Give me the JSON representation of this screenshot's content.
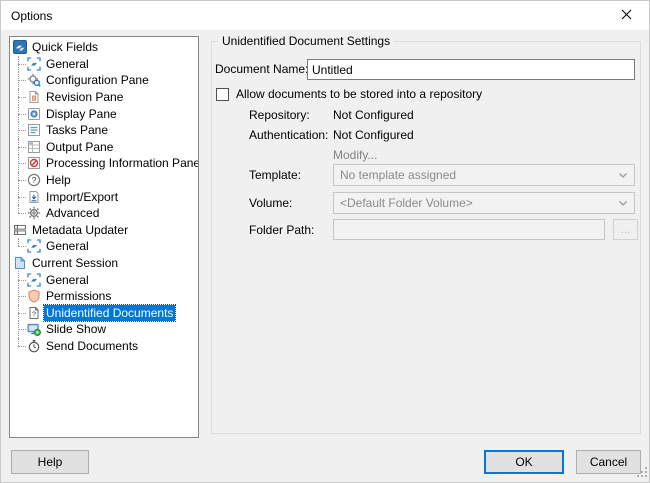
{
  "window": {
    "title": "Options"
  },
  "tree": {
    "items": [
      {
        "label": "Quick Fields",
        "level": 0,
        "icon": "quick-fields",
        "selected": false
      },
      {
        "label": "General",
        "level": 1,
        "icon": "general",
        "selected": false
      },
      {
        "label": "Configuration Pane",
        "level": 1,
        "icon": "configuration-pane",
        "selected": false
      },
      {
        "label": "Revision Pane",
        "level": 1,
        "icon": "revision-pane",
        "selected": false
      },
      {
        "label": "Display Pane",
        "level": 1,
        "icon": "display-pane",
        "selected": false
      },
      {
        "label": "Tasks Pane",
        "level": 1,
        "icon": "tasks-pane",
        "selected": false
      },
      {
        "label": "Output Pane",
        "level": 1,
        "icon": "output-pane",
        "selected": false
      },
      {
        "label": "Processing Information Pane",
        "level": 1,
        "icon": "processing-info-pane",
        "selected": false
      },
      {
        "label": "Help",
        "level": 1,
        "icon": "help",
        "selected": false
      },
      {
        "label": "Import/Export",
        "level": 1,
        "icon": "import-export",
        "selected": false
      },
      {
        "label": "Advanced",
        "level": 1,
        "icon": "advanced",
        "selected": false
      },
      {
        "label": "Metadata Updater",
        "level": 0,
        "icon": "metadata-updater",
        "selected": false
      },
      {
        "label": "General",
        "level": 1,
        "icon": "general",
        "selected": false
      },
      {
        "label": "Current Session",
        "level": 0,
        "icon": "current-session",
        "selected": false
      },
      {
        "label": "General",
        "level": 1,
        "icon": "general",
        "selected": false
      },
      {
        "label": "Permissions",
        "level": 1,
        "icon": "permissions",
        "selected": false
      },
      {
        "label": "Unidentified Documents",
        "level": 1,
        "icon": "unidentified-documents",
        "selected": true
      },
      {
        "label": "Slide Show",
        "level": 1,
        "icon": "slide-show",
        "selected": false
      },
      {
        "label": "Send Documents",
        "level": 1,
        "icon": "send-documents",
        "selected": false
      }
    ]
  },
  "panel": {
    "group_title": "Unidentified Document Settings",
    "document_name": {
      "label": "Document Name:",
      "value": "Untitled"
    },
    "allow_repository": {
      "label": "Allow documents to be stored into a repository",
      "checked": false
    },
    "repository": {
      "label": "Repository:",
      "value": "Not Configured"
    },
    "authentication": {
      "label": "Authentication:",
      "value": "Not Configured"
    },
    "modify_label": "Modify...",
    "template": {
      "label": "Template:",
      "value": "No template assigned"
    },
    "volume": {
      "label": "Volume:",
      "value": "<Default Folder Volume>"
    },
    "folder_path": {
      "label": "Folder Path:",
      "value": "",
      "browse_label": "..."
    }
  },
  "footer": {
    "help_label": "Help",
    "ok_label": "OK",
    "cancel_label": "Cancel"
  },
  "colors": {
    "accent": "#0078d7",
    "selection_background": "#0078d7",
    "dialog_background": "#f0f0f0",
    "titlebar_background": "#ffffff"
  }
}
